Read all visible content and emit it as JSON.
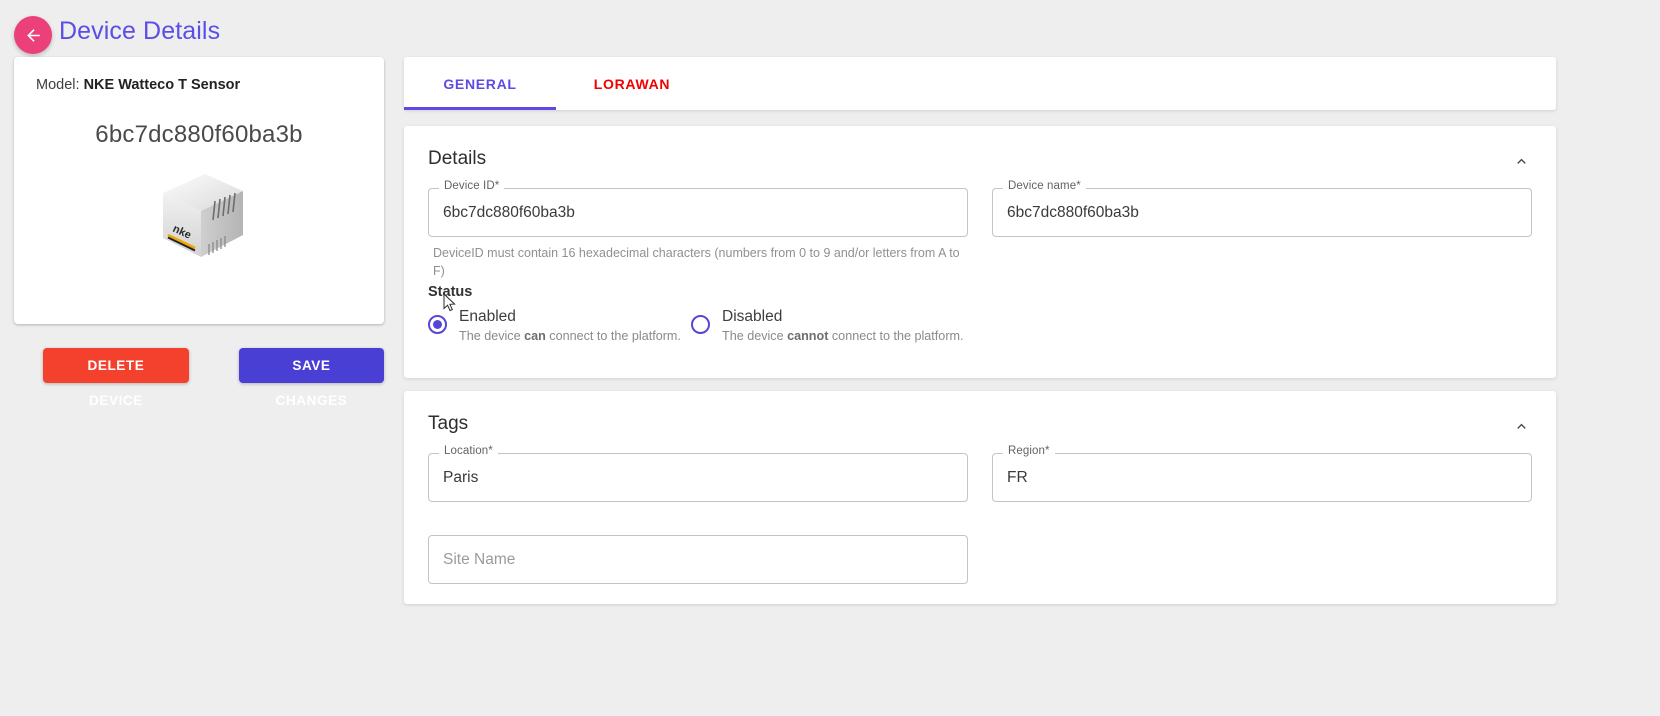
{
  "header": {
    "title": "Device Details",
    "back_icon": "arrow-left-icon",
    "back_color": "#ec407a",
    "title_color": "#5c4ee5"
  },
  "device_card": {
    "model_prefix": "Model:",
    "model_name": "NKE Watteco T Sensor",
    "device_uid": "6bc7dc880f60ba3b",
    "image_alt": "nke-watteco-t-sensor-photo"
  },
  "actions": {
    "delete_label": "DELETE DEVICE",
    "save_label": "SAVE CHANGES",
    "delete_color": "#f4412e",
    "save_color": "#4a3fd4"
  },
  "tabs": [
    {
      "label": "GENERAL",
      "active": true,
      "color": "#5e4ae3"
    },
    {
      "label": "LORAWAN",
      "active": false,
      "color": "#f10000"
    }
  ],
  "details": {
    "title": "Details",
    "collapse_icon": "chevron-up-icon",
    "device_id": {
      "label": "Device ID*",
      "value": "6bc7dc880f60ba3b",
      "helper": "DeviceID must contain 16 hexadecimal characters (numbers from 0 to 9 and/or letters from A to F)"
    },
    "device_name": {
      "label": "Device name*",
      "value": "6bc7dc880f60ba3b"
    },
    "status": {
      "label": "Status",
      "selected": "Enabled",
      "options": [
        {
          "title": "Enabled",
          "desc_before": "The device ",
          "desc_bold": "can",
          "desc_after": " connect to the platform.",
          "checked": true
        },
        {
          "title": "Disabled",
          "desc_before": "The device ",
          "desc_bold": "cannot",
          "desc_after": " connect to the platform.",
          "checked": false
        }
      ]
    }
  },
  "tags": {
    "title": "Tags",
    "collapse_icon": "chevron-up-icon",
    "location": {
      "label": "Location*",
      "value": "Paris"
    },
    "region": {
      "label": "Region*",
      "value": "FR"
    },
    "site_name": {
      "placeholder": "Site Name",
      "value": ""
    }
  }
}
